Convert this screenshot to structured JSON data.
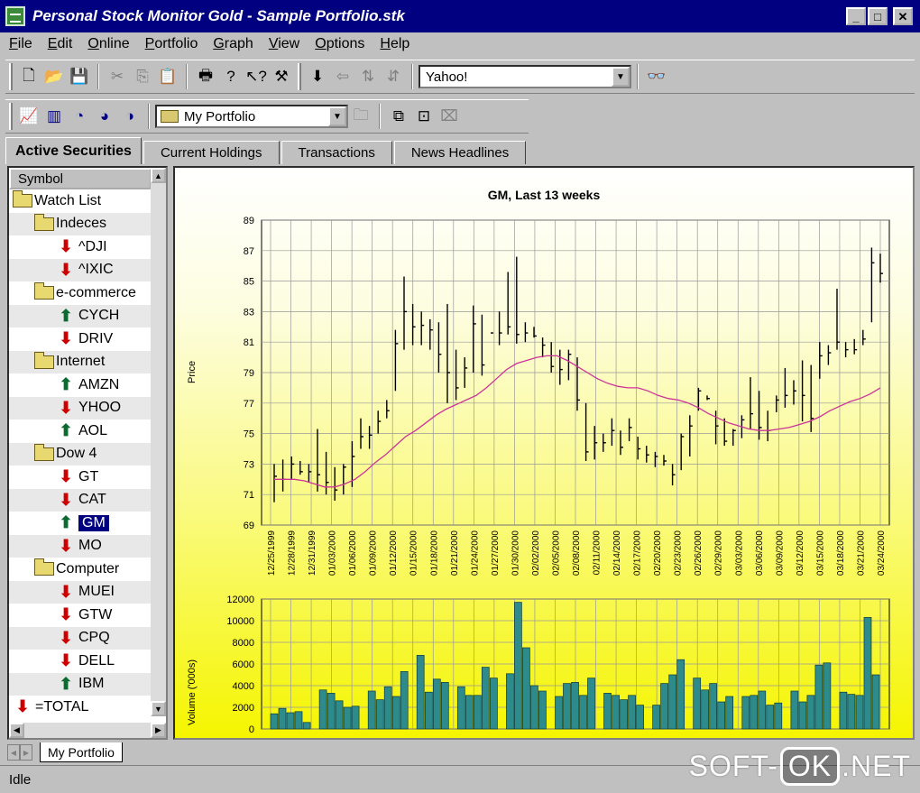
{
  "window": {
    "title": "Personal Stock Monitor Gold - Sample Portfolio.stk"
  },
  "menu": [
    "File",
    "Edit",
    "Online",
    "Portfolio",
    "Graph",
    "View",
    "Options",
    "Help"
  ],
  "toolbar": {
    "source_value": "Yahoo!",
    "portfolio_value": "My Portfolio"
  },
  "tabs": [
    "Active Securities",
    "Current Holdings",
    "Transactions",
    "News Headlines"
  ],
  "tree": {
    "header": "Symbol",
    "rows": [
      {
        "label": "Watch List",
        "kind": "folder",
        "level": 0
      },
      {
        "label": "Indeces",
        "kind": "folder",
        "level": 1
      },
      {
        "label": "^DJI",
        "kind": "down",
        "level": 2
      },
      {
        "label": "^IXIC",
        "kind": "down",
        "level": 2
      },
      {
        "label": "e-commerce",
        "kind": "folder",
        "level": 1
      },
      {
        "label": "CYCH",
        "kind": "up",
        "level": 2
      },
      {
        "label": "DRIV",
        "kind": "down",
        "level": 2
      },
      {
        "label": "Internet",
        "kind": "folder",
        "level": 1
      },
      {
        "label": "AMZN",
        "kind": "up",
        "level": 2
      },
      {
        "label": "YHOO",
        "kind": "down",
        "level": 2
      },
      {
        "label": "AOL",
        "kind": "up",
        "level": 2
      },
      {
        "label": "Dow 4",
        "kind": "folder",
        "level": 1
      },
      {
        "label": "GT",
        "kind": "down",
        "level": 2
      },
      {
        "label": "CAT",
        "kind": "down",
        "level": 2
      },
      {
        "label": "GM",
        "kind": "up",
        "level": 2,
        "selected": true
      },
      {
        "label": "MO",
        "kind": "down",
        "level": 2
      },
      {
        "label": "Computer",
        "kind": "folder",
        "level": 1
      },
      {
        "label": "MUEI",
        "kind": "down",
        "level": 2
      },
      {
        "label": "GTW",
        "kind": "down",
        "level": 2
      },
      {
        "label": "CPQ",
        "kind": "down",
        "level": 2
      },
      {
        "label": "DELL",
        "kind": "down",
        "level": 2
      },
      {
        "label": "IBM",
        "kind": "up",
        "level": 2
      },
      {
        "label": "=TOTAL",
        "kind": "down",
        "level": 0
      }
    ]
  },
  "sheet_tab": "My Portfolio",
  "status": "Idle",
  "watermark": {
    "left": "SOFT-",
    "box": "OK",
    "right": ".NET"
  },
  "colors": {
    "titlebar": "#000080",
    "bar_fill": "#2e8b8b",
    "ma_line": "#cc3399",
    "down_arrow": "#cc0000",
    "up_arrow": "#0a6a30"
  },
  "chart_data": {
    "type": "line",
    "title": "GM, Last 13 weeks",
    "price_chart": {
      "ylabel": "Price",
      "ylim": [
        69,
        89
      ],
      "yticks": [
        69,
        71,
        73,
        75,
        77,
        79,
        81,
        83,
        85,
        87,
        89
      ],
      "date_labels": [
        "12/25/1999",
        "12/28/1999",
        "12/31/1999",
        "01/03/2000",
        "01/06/2000",
        "01/09/2000",
        "01/12/2000",
        "01/15/2000",
        "01/18/2000",
        "01/21/2000",
        "01/24/2000",
        "01/27/2000",
        "01/30/2000",
        "02/02/2000",
        "02/05/2000",
        "02/08/2000",
        "02/11/2000",
        "02/14/2000",
        "02/17/2000",
        "02/20/2000",
        "02/23/2000",
        "02/26/2000",
        "02/29/2000",
        "03/03/2000",
        "03/06/2000",
        "03/09/2000",
        "03/12/2000",
        "03/15/2000",
        "03/18/2000",
        "03/21/2000",
        "03/24/2000"
      ],
      "series": [
        {
          "name": "HLC",
          "high": [
            73,
            73.3,
            73.5,
            73.2,
            73,
            75.3,
            73.8,
            72.8,
            73,
            74.5,
            76,
            75.5,
            76.5,
            77.2,
            81.8,
            85.3,
            83.5,
            83,
            82.5,
            82.3,
            83.5,
            80.5,
            80,
            83.4,
            82.8,
            80.5,
            83,
            85.6,
            86.6,
            82.3,
            82,
            81.3,
            81,
            80.5,
            80.5,
            80,
            77,
            75.5,
            75,
            76,
            75.2,
            76,
            74.8,
            74.2,
            73.8,
            73.6,
            73,
            75,
            76.2,
            78,
            77.5,
            76.5,
            76,
            75.3,
            76.2,
            78.7,
            77.8,
            76.5,
            77.5,
            79.3,
            78.5,
            79.8,
            79.5,
            81,
            80.8,
            84.5,
            81,
            81.2,
            81.8,
            87.2,
            86.8
          ],
          "low": [
            70.5,
            71.2,
            72,
            72.3,
            71.8,
            71.2,
            71,
            70.6,
            71,
            71.5,
            74,
            74,
            75,
            76,
            77.8,
            80.5,
            80.8,
            80.8,
            80.5,
            79,
            77,
            77.2,
            78,
            79,
            78.8,
            80.5,
            80.8,
            81.5,
            80.9,
            81,
            81.3,
            80,
            79,
            78.2,
            78.5,
            76.5,
            73.2,
            73.3,
            73.8,
            74.2,
            73.6,
            74.5,
            73.3,
            73.1,
            72.8,
            72.9,
            71.6,
            72.6,
            73.5,
            76.5,
            77.2,
            74.3,
            74.2,
            74.2,
            74.7,
            75.3,
            74.6,
            74.5,
            76.4,
            76.7,
            76.9,
            75.8,
            75.1,
            78.6,
            79.5,
            80.5,
            80,
            80.2,
            80.8,
            82.3,
            84.9
          ],
          "close": [
            72.2,
            72,
            73,
            72.5,
            72.5,
            72.3,
            71.8,
            71.3,
            72.8,
            73.5,
            74.8,
            74.9,
            75.8,
            76.5,
            80.9,
            83,
            82,
            82.1,
            81.8,
            80.2,
            79,
            78,
            79.3,
            82.2,
            79.5,
            81.6,
            81.6,
            82,
            81.5,
            81.6,
            81.4,
            80.8,
            79.4,
            79.2,
            80.2,
            77.2,
            73.8,
            74.4,
            74.4,
            75.2,
            74.1,
            75.4,
            74,
            73.6,
            73.5,
            73.2,
            72.3,
            74.8,
            75.5,
            77.8,
            77.3,
            75.5,
            74.5,
            75.2,
            75.9,
            76.3,
            75.4,
            75.2,
            77.2,
            77.5,
            77.8,
            77.5,
            76,
            80.1,
            80.3,
            81,
            80.5,
            80.5,
            81.2,
            86.2,
            85.5
          ]
        },
        {
          "name": "MA",
          "values": [
            72,
            72,
            72,
            71.9,
            71.7,
            71.5,
            71.5,
            71.7,
            72,
            72.5,
            73.1,
            73.6,
            74.2,
            74.8,
            75.2,
            75.7,
            76.2,
            76.6,
            76.9,
            77.2,
            77.5,
            78,
            78.6,
            79.2,
            79.6,
            79.8,
            80,
            80.1,
            80.1,
            79.8,
            79.4,
            79,
            78.6,
            78.3,
            78.1,
            78,
            78,
            77.8,
            77.5,
            77.3,
            77.2,
            77,
            76.7,
            76.3,
            76,
            75.7,
            75.5,
            75.3,
            75.2,
            75.2,
            75.3,
            75.4,
            75.6,
            75.8,
            76.1,
            76.5,
            76.8,
            77.1,
            77.3,
            77.6,
            78
          ]
        }
      ]
    },
    "volume_chart": {
      "ylabel": "Volume ('000s)",
      "ylim": [
        0,
        12000
      ],
      "yticks": [
        0,
        2000,
        4000,
        6000,
        8000,
        10000,
        12000
      ],
      "values": [
        1400,
        1900,
        1500,
        1600,
        600,
        0,
        3600,
        3300,
        2600,
        2000,
        2100,
        0,
        3500,
        2700,
        3900,
        3000,
        5300,
        0,
        6800,
        3400,
        4600,
        4300,
        0,
        3900,
        3100,
        3100,
        5700,
        4700,
        0,
        5100,
        11700,
        7500,
        4000,
        3500,
        0,
        3000,
        4200,
        4300,
        3100,
        4700,
        0,
        3300,
        3100,
        2700,
        3100,
        2200,
        0,
        2200,
        4200,
        5000,
        6400,
        0,
        4700,
        3600,
        4200,
        2500,
        3000,
        0,
        3000,
        3100,
        3500,
        2200,
        2400,
        0,
        3500,
        2500,
        3100,
        5900,
        6100,
        0,
        3400,
        3200,
        3100,
        10300,
        5000
      ]
    }
  }
}
